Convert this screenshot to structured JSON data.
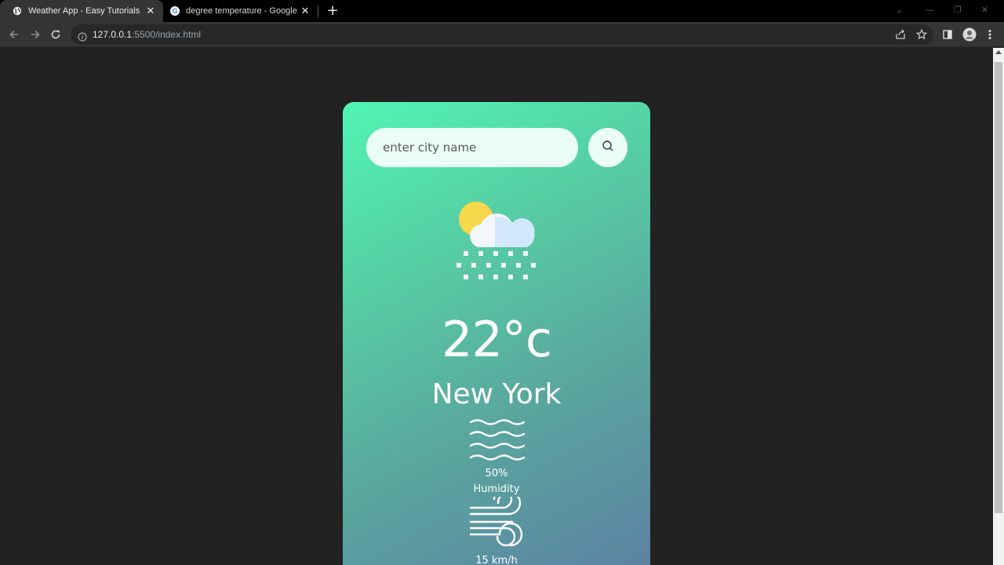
{
  "browser": {
    "tabs": [
      {
        "title": "Weather App - Easy Tutorials",
        "active": true,
        "favicon": "globe-icon"
      },
      {
        "title": "degree temperature - Google Se",
        "active": false,
        "favicon": "google-icon"
      }
    ],
    "address": {
      "host": "127.0.0.1",
      "path": ":5500/index.html"
    }
  },
  "app": {
    "search": {
      "placeholder": "enter city name",
      "value": ""
    },
    "weather_icon": "sun-cloud-snow-icon",
    "temperature": "22°c",
    "city": "New York",
    "humidity": {
      "value": "50%",
      "label": "Humidity",
      "icon": "humidity-waves-icon"
    },
    "wind": {
      "value": "15 km/h",
      "icon": "wind-icon"
    }
  },
  "colors": {
    "card_gradient_start": "#51f5b4",
    "card_gradient_end": "#5c7fa3",
    "page_background": "#222222"
  }
}
